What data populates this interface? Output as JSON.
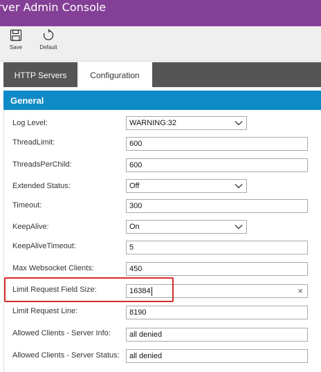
{
  "window": {
    "title": "rver Admin Console"
  },
  "toolbar": {
    "save_label": "Save",
    "default_label": "Default"
  },
  "tabs": [
    {
      "label": "HTTP Servers"
    },
    {
      "label": "Configuration"
    }
  ],
  "section": {
    "title": "General"
  },
  "fields": [
    {
      "label": "Log Level:",
      "value": "WARNING:32"
    },
    {
      "label": "ThreadLimit:",
      "value": "600"
    },
    {
      "label": "ThreadsPerChild:",
      "value": "600"
    },
    {
      "label": "Extended Status:",
      "value": "Off"
    },
    {
      "label": "Timeout:",
      "value": "300"
    },
    {
      "label": "KeepAlive:",
      "value": "On"
    },
    {
      "label": "KeepAliveTimeout:",
      "value": "5"
    },
    {
      "label": "Max Websocket Clients:",
      "value": "450"
    },
    {
      "label": "Limit Request Field Size:",
      "value": "16384"
    },
    {
      "label": "Limit Request Line:",
      "value": "8190"
    },
    {
      "label": "Allowed Clients - Server Info:",
      "value": "all denied"
    },
    {
      "label": "Allowed Clients - Server Status:",
      "value": "all denied"
    }
  ],
  "clear_glyph": "×",
  "colors": {
    "titlebar": "#843f96",
    "section_header": "#0e8ac7",
    "tabbar": "#555555",
    "highlight": "#d62b2b"
  }
}
